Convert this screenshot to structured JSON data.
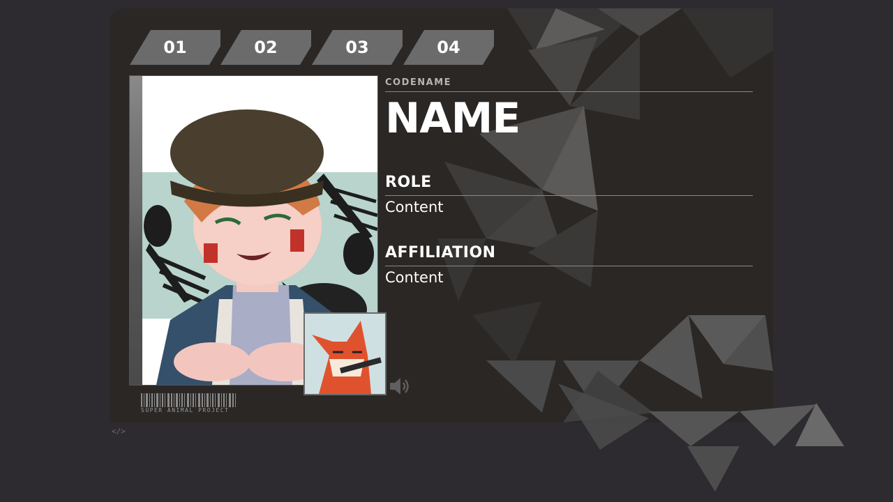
{
  "tabs": [
    {
      "label": "01"
    },
    {
      "label": "02"
    },
    {
      "label": "03"
    },
    {
      "label": "04"
    }
  ],
  "profile": {
    "codename_label": "CODENAME",
    "name": "NAME",
    "role_label": "ROLE",
    "role_content": "Content",
    "affiliation_label": "AFFILIATION",
    "affiliation_content": "Content"
  },
  "footer": {
    "barcode_text": "SUPER ANIMAL PROJECT",
    "code_icon": "</>"
  },
  "icons": {
    "speaker": "speaker-icon",
    "code": "code-icon"
  },
  "colors": {
    "page_bg": "#2d2b2f",
    "card_bg": "#2a2725",
    "tab_bg": "#6b6b6b",
    "text": "#ffffff",
    "muted": "#b5b5b5"
  }
}
